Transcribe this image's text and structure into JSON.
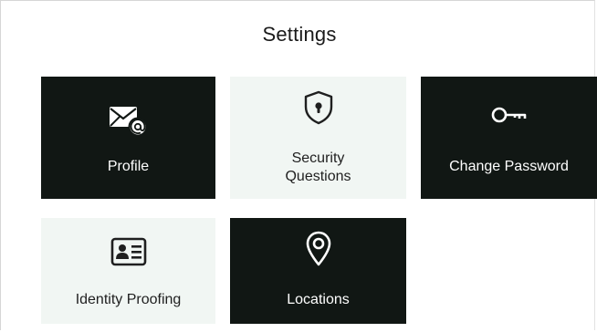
{
  "page": {
    "title": "Settings"
  },
  "tiles": [
    {
      "label": "Profile",
      "icon": "envelope-at-icon",
      "theme": "dark"
    },
    {
      "label_line1": "Security",
      "label_line2": "Questions",
      "icon": "shield-keyhole-icon",
      "theme": "light"
    },
    {
      "label": "Change Password",
      "icon": "key-icon",
      "theme": "dark"
    },
    {
      "label": "Identity Proofing",
      "icon": "id-card-icon",
      "theme": "light"
    },
    {
      "label": "Locations",
      "icon": "map-pin-icon",
      "theme": "dark"
    }
  ],
  "colors": {
    "dark_tile": "#111714",
    "light_tile": "#f1f6f3",
    "dark_text": "#ffffff",
    "light_text": "#1f1f1f"
  }
}
